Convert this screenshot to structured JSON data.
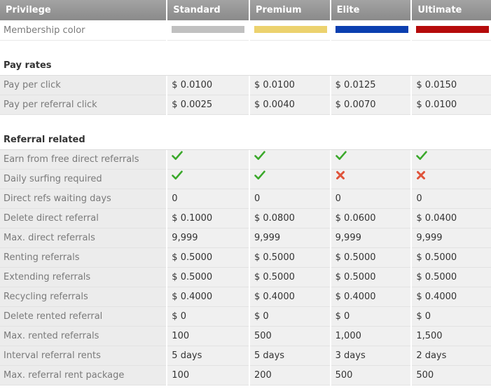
{
  "header": {
    "privilege": "Privilege",
    "tiers": [
      "Standard",
      "Premium",
      "Elite",
      "Ultimate"
    ]
  },
  "membership": {
    "label": "Membership color",
    "colors": [
      "#c0c0c0",
      "#ecd26e",
      "#0b3fb0",
      "#b50b0b"
    ]
  },
  "sections": {
    "pay_rates": {
      "title": "Pay rates",
      "rows": [
        {
          "label": "Pay per click",
          "values": [
            "$ 0.0100",
            "$ 0.0100",
            "$ 0.0125",
            "$ 0.0150"
          ]
        },
        {
          "label": "Pay per referral click",
          "values": [
            "$ 0.0025",
            "$ 0.0040",
            "$ 0.0070",
            "$ 0.0100"
          ]
        }
      ]
    },
    "referral": {
      "title": "Referral related",
      "icon_rows": [
        {
          "label": "Earn from free direct referrals",
          "icons": [
            "check-icon",
            "check-icon",
            "check-icon",
            "check-icon"
          ]
        },
        {
          "label": "Daily surfing required",
          "icons": [
            "check-icon",
            "check-icon",
            "cross-icon",
            "cross-icon"
          ]
        }
      ],
      "rows": [
        {
          "label": "Direct refs waiting days",
          "values": [
            "0",
            "0",
            "0",
            "0"
          ]
        },
        {
          "label": "Delete direct referral",
          "values": [
            "$ 0.1000",
            "$ 0.0800",
            "$ 0.0600",
            "$ 0.0400"
          ]
        },
        {
          "label": "Max. direct referrals",
          "values": [
            "9,999",
            "9,999",
            "9,999",
            "9,999"
          ]
        },
        {
          "label": "Renting referrals",
          "values": [
            "$ 0.5000",
            "$ 0.5000",
            "$ 0.5000",
            "$ 0.5000"
          ]
        },
        {
          "label": "Extending referrals",
          "values": [
            "$ 0.5000",
            "$ 0.5000",
            "$ 0.5000",
            "$ 0.5000"
          ]
        },
        {
          "label": "Recycling referrals",
          "values": [
            "$ 0.4000",
            "$ 0.4000",
            "$ 0.4000",
            "$ 0.4000"
          ]
        },
        {
          "label": "Delete rented referral",
          "values": [
            "$ 0",
            "$ 0",
            "$ 0",
            "$ 0"
          ]
        },
        {
          "label": "Max. rented referrals",
          "values": [
            "100",
            "500",
            "1,000",
            "1,500"
          ]
        },
        {
          "label": "Interval referral rents",
          "values": [
            "5 days",
            "5 days",
            "3 days",
            "2 days"
          ]
        },
        {
          "label": "Max. referral rent package",
          "values": [
            "100",
            "200",
            "500",
            "500"
          ]
        }
      ]
    }
  },
  "icon_colors": {
    "check": "#3aa82a",
    "cross": "#e0533a"
  }
}
